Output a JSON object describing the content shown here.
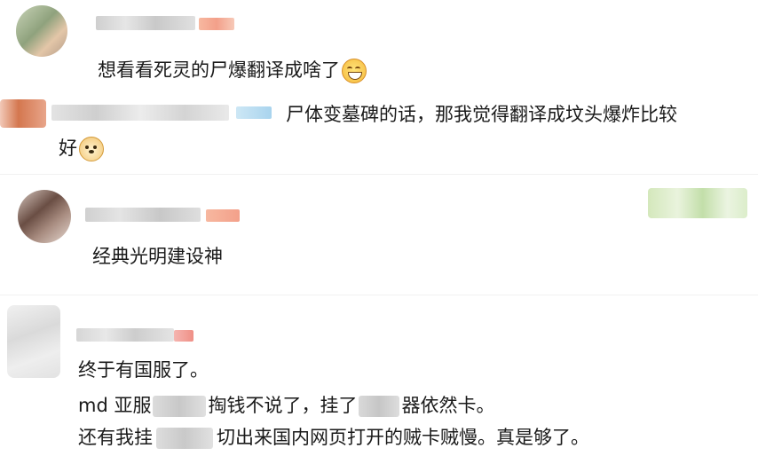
{
  "comments": [
    {
      "text": "想看看死灵的尸爆翻译成啥了"
    },
    {
      "text_line1": "尸体变墓碑的话，那我觉得翻译成坟头爆炸比较",
      "text_line2": "好"
    },
    {
      "text": "经典光明建设神"
    },
    {
      "line1": "终于有国服了。",
      "line2_a": "md 亚服",
      "line2_b": "掏钱不说了，挂了",
      "line2_c": "器依然卡。",
      "line3_a": "还有我挂",
      "line3_b": "切出来国内网页打开的贼卡贼慢。真是够了。"
    }
  ],
  "icons": {
    "grin_emoji": "grin-emoji-icon",
    "doge_emoji": "doge-emoji-icon"
  },
  "colors": {
    "text": "#1a1a1a",
    "blur_gray": "#d9d9d9",
    "blur_red": "#f3a08a",
    "blur_green": "#b9d99a"
  }
}
